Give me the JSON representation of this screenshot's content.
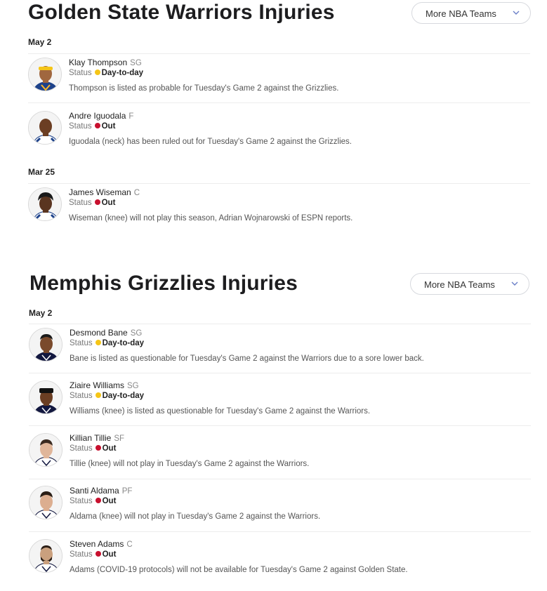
{
  "colors": {
    "day_to_day": "#f5c517",
    "out": "#c8102e",
    "warriors_jersey": "#1d428a",
    "grizzlies_jersey": "#12173f"
  },
  "warriors": {
    "title": "Golden State Warriors Injuries",
    "more_button": "More NBA Teams",
    "groups": [
      {
        "date": "May 2",
        "players": [
          {
            "name": "Klay Thompson",
            "pos": "SG",
            "status_label": "Status",
            "status": "Day-to-day",
            "note": "Thompson is listed as probable for Tuesday's Game 2 against the Grizzlies."
          },
          {
            "name": "Andre Iguodala",
            "pos": "F",
            "status_label": "Status",
            "status": "Out",
            "note": "Iguodala (neck) has been ruled out for Tuesday's Game 2 against the Grizzlies."
          }
        ]
      },
      {
        "date": "Mar 25",
        "players": [
          {
            "name": "James Wiseman",
            "pos": "C",
            "status_label": "Status",
            "status": "Out",
            "note": "Wiseman (knee) will not play this season, Adrian Wojnarowski of ESPN reports."
          }
        ]
      }
    ]
  },
  "grizzlies": {
    "title": "Memphis Grizzlies Injuries",
    "more_button": "More NBA Teams",
    "groups": [
      {
        "date": "May 2",
        "players": [
          {
            "name": "Desmond Bane",
            "pos": "SG",
            "status_label": "Status",
            "status": "Day-to-day",
            "note": "Bane is listed as questionable for Tuesday's Game 2 against the Warriors due to a sore lower back."
          },
          {
            "name": "Ziaire Williams",
            "pos": "SG",
            "status_label": "Status",
            "status": "Day-to-day",
            "note": "Williams (knee) is listed as questionable for Tuesday's Game 2 against the Warriors."
          },
          {
            "name": "Killian Tillie",
            "pos": "SF",
            "status_label": "Status",
            "status": "Out",
            "note": "Tillie (knee) will not play in Tuesday's Game 2 against the Warriors."
          },
          {
            "name": "Santi Aldama",
            "pos": "PF",
            "status_label": "Status",
            "status": "Out",
            "note": "Aldama (knee) will not play in Tuesday's Game 2 against the Warriors."
          },
          {
            "name": "Steven Adams",
            "pos": "C",
            "status_label": "Status",
            "status": "Out",
            "note": "Adams (COVID-19 protocols) will not be available for Tuesday's Game 2 against Golden State."
          }
        ]
      }
    ]
  }
}
